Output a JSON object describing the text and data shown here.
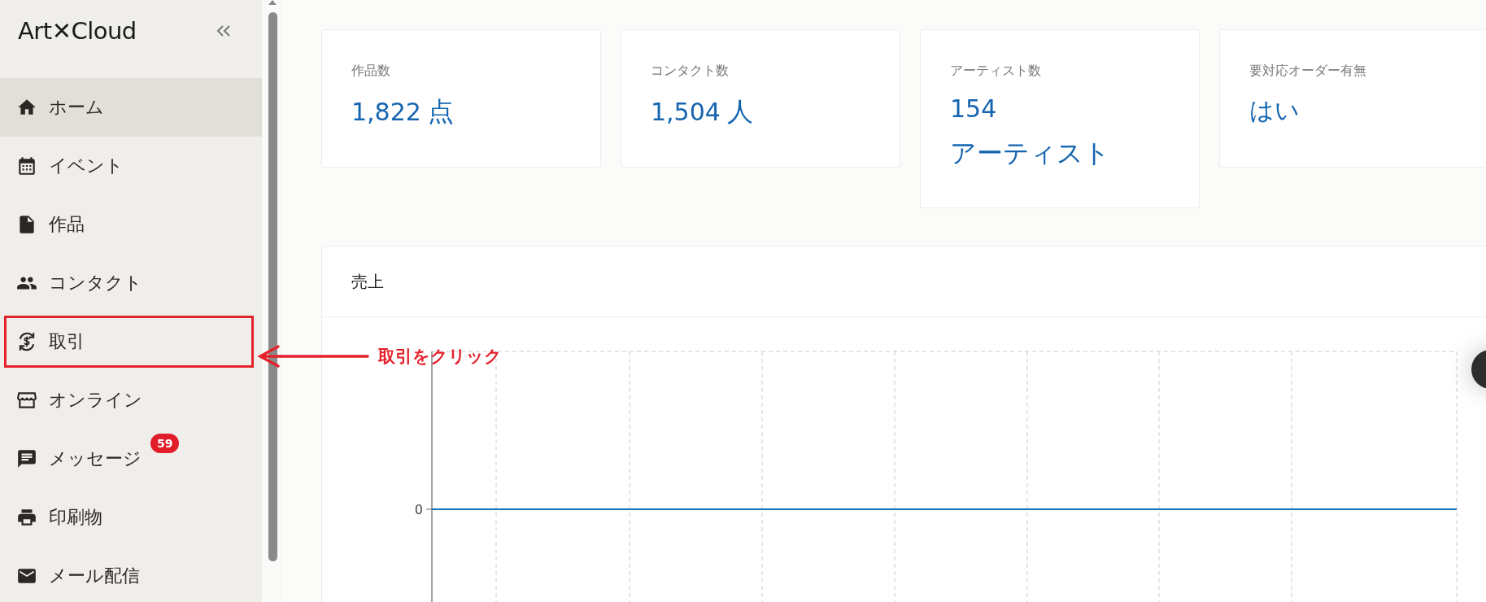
{
  "sidebar": {
    "logo": "Art✕Cloud",
    "items": [
      {
        "label": "ホーム",
        "selected": true,
        "annotated": false
      },
      {
        "label": "イベント",
        "selected": false,
        "annotated": false
      },
      {
        "label": "作品",
        "selected": false,
        "annotated": false
      },
      {
        "label": "コンタクト",
        "selected": false,
        "annotated": false
      },
      {
        "label": "取引",
        "selected": false,
        "annotated": true
      },
      {
        "label": "オンライン",
        "selected": false,
        "annotated": false
      },
      {
        "label": "メッセージ",
        "selected": false,
        "annotated": false,
        "badge": "59"
      },
      {
        "label": "印刷物",
        "selected": false,
        "annotated": false
      },
      {
        "label": "メール配信",
        "selected": false,
        "annotated": false
      }
    ]
  },
  "stats": [
    {
      "label": "作品数",
      "value": "1,822",
      "unit": "点"
    },
    {
      "label": "コンタクト数",
      "value": "1,504",
      "unit": "人"
    },
    {
      "label": "アーティスト数",
      "value": "154",
      "unit": "アーティスト"
    },
    {
      "label": "要対応オーダー有無",
      "value": "はい"
    }
  ],
  "sales_panel": {
    "title": "売上",
    "y_tick_label": "0"
  },
  "annotation": {
    "text": "取引をクリック"
  }
}
